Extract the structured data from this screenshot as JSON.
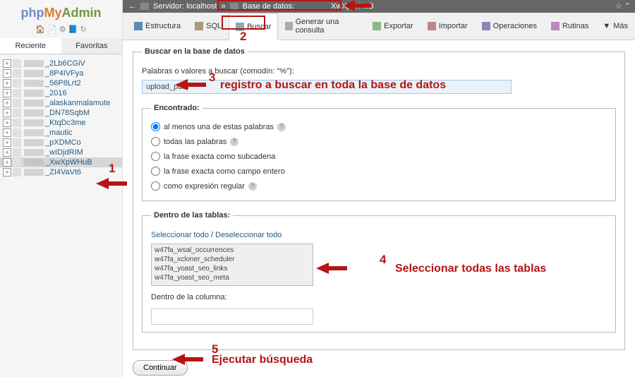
{
  "logo": {
    "php": "php",
    "my": "My",
    "admin": "Admin"
  },
  "sidebar_tabs": {
    "recent": "Reciente",
    "favorites": "Favoritas"
  },
  "databases": [
    "_2Lb6CGiV",
    "_8P4IVFya",
    "_56P8Lrt2",
    "_2016",
    "_alaskanmalamute",
    "_DN78SqbM",
    "_KtqDc3me",
    "_mautic",
    "_pXDMCo",
    "_wIDjdRIM",
    "_XwXpWHuB",
    "_ZI4VaVt6"
  ],
  "breadcrumb": {
    "server_label": "Servidor: localhost",
    "db_label": "Base de datos:",
    "db_name": "XwXpWHuB"
  },
  "tabs": {
    "structure": "Estructura",
    "sql": "SQL",
    "search": "Buscar",
    "query": "Generar una consulta",
    "export": "Exportar",
    "import": "Importar",
    "operations": "Operaciones",
    "routines": "Rutinas",
    "more": "Más"
  },
  "search": {
    "fieldset_title": "Buscar en la base de datos",
    "prompt": "Palabras o valores a buscar (comodín: \"%\"):",
    "value": "upload_path",
    "find_legend": "Encontrado:",
    "opt1": "al menos una de estas palabras",
    "opt2": "todas las palabras",
    "opt3": "la frase exacta como subcadena",
    "opt4": "la frase exacta como campo entero",
    "opt5": "como expresión regular",
    "tables_legend": "Dentro de las tablas:",
    "select_all": "Seleccionar todo",
    "deselect_all": "Deseleccionar todo",
    "table_options": [
      "w47fa_wsal_occurrences",
      "w47fa_xcloner_scheduler",
      "w47fa_yoast_seo_links",
      "w47fa_yoast_seo_meta"
    ],
    "column_label": "Dentro de la columna:",
    "submit": "Continuar"
  },
  "annotations": {
    "n1": "1",
    "n2": "2",
    "n3": "3",
    "n4": "4",
    "n5": "5",
    "text3": "registro a buscar en toda la base de datos",
    "text4": "Seleccionar todas las tablas",
    "text5": "Ejecutar búsqueda"
  }
}
